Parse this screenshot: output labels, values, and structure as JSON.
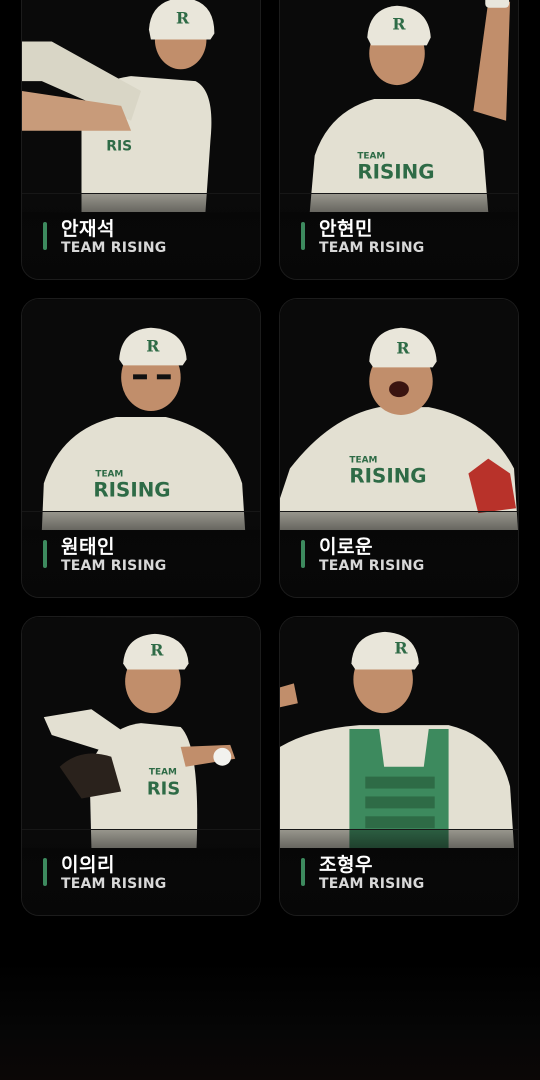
{
  "players": [
    {
      "name": "안재석",
      "team": "TEAM RISING",
      "icon": "player-batting-photo"
    },
    {
      "name": "안현민",
      "team": "TEAM RISING",
      "icon": "player-raised-arm-photo"
    },
    {
      "name": "원태인",
      "team": "TEAM RISING",
      "icon": "player-eyeblack-photo"
    },
    {
      "name": "이로운",
      "team": "TEAM RISING",
      "icon": "player-shouting-photo"
    },
    {
      "name": "이의리",
      "team": "TEAM RISING",
      "icon": "player-pitching-photo"
    },
    {
      "name": "조형우",
      "team": "TEAM RISING",
      "icon": "player-catcher-photo"
    }
  ],
  "jersey": {
    "logo_letter": "R",
    "chest_text": "RISING",
    "chest_text_short": "RIS",
    "team_small": "TEAM"
  },
  "colors": {
    "accent_green": "#3d8a5e",
    "jersey_cream": "#e6e3d6",
    "background": "#000000"
  }
}
